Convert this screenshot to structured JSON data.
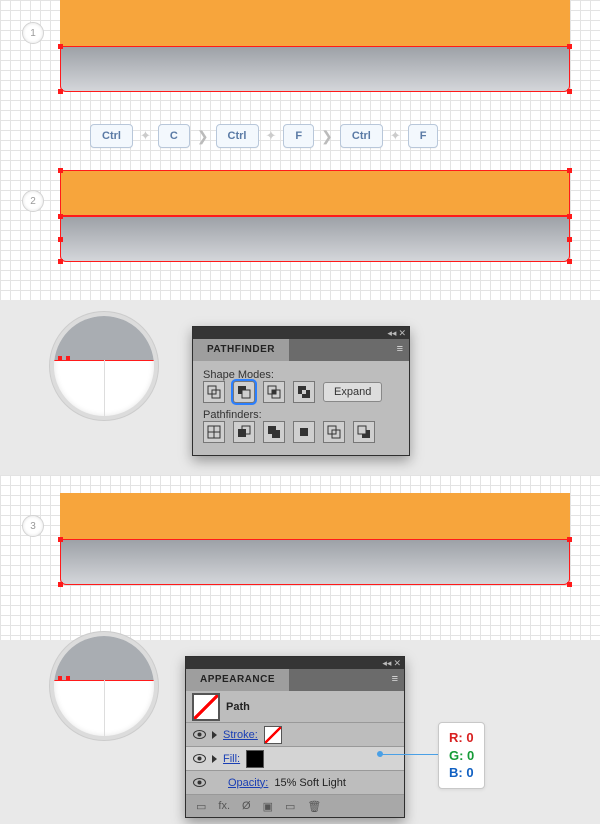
{
  "steps": {
    "s1": "1",
    "s2": "2",
    "s3": "3"
  },
  "shortcut": {
    "k1": "Ctrl",
    "k2": "C",
    "k3": "Ctrl",
    "k4": "F",
    "k5": "Ctrl",
    "k6": "F"
  },
  "pathfinder": {
    "title": "PATHFINDER",
    "shape_modes_label": "Shape Modes:",
    "pathfinders_label": "Pathfinders:",
    "expand_label": "Expand"
  },
  "appearance": {
    "title": "APPEARANCE",
    "path_label": "Path",
    "stroke_label": "Stroke:",
    "fill_label": "Fill:",
    "opacity_label": "Opacity:",
    "opacity_value": "15% Soft Light"
  },
  "rgb": {
    "r": "R: 0",
    "g": "G: 0",
    "b": "B: 0"
  },
  "colors": {
    "r": "#d82020",
    "g": "#159b37",
    "b": "#1060c2"
  },
  "icons": {
    "flyout": "◂◂",
    "close": "✕",
    "menu": "≡",
    "fx": "fx."
  }
}
